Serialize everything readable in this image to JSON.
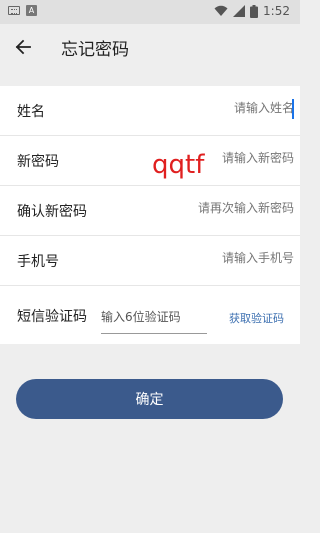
{
  "status_bar": {
    "time": "1:52",
    "icons": [
      "keyboard-icon",
      "a-icon",
      "wifi-icon",
      "signal-icon",
      "battery-icon"
    ]
  },
  "header": {
    "title": "忘记密码",
    "back_icon": "arrow-left-icon"
  },
  "form": {
    "rows": [
      {
        "label": "姓名",
        "placeholder": "请输入姓名"
      },
      {
        "label": "新密码",
        "placeholder": "请输入新密码"
      },
      {
        "label": "确认新密码",
        "placeholder": "请再次输入新密码"
      },
      {
        "label": "手机号",
        "placeholder": "请输入手机号"
      },
      {
        "label": "短信验证码",
        "placeholder": "输入6位验证码",
        "action": "获取验证码"
      }
    ]
  },
  "watermark": "qqtf",
  "confirm_label": "确定",
  "colors": {
    "accent": "#3b5a8c",
    "link": "#3c6fb0",
    "watermark": "#e02020"
  }
}
